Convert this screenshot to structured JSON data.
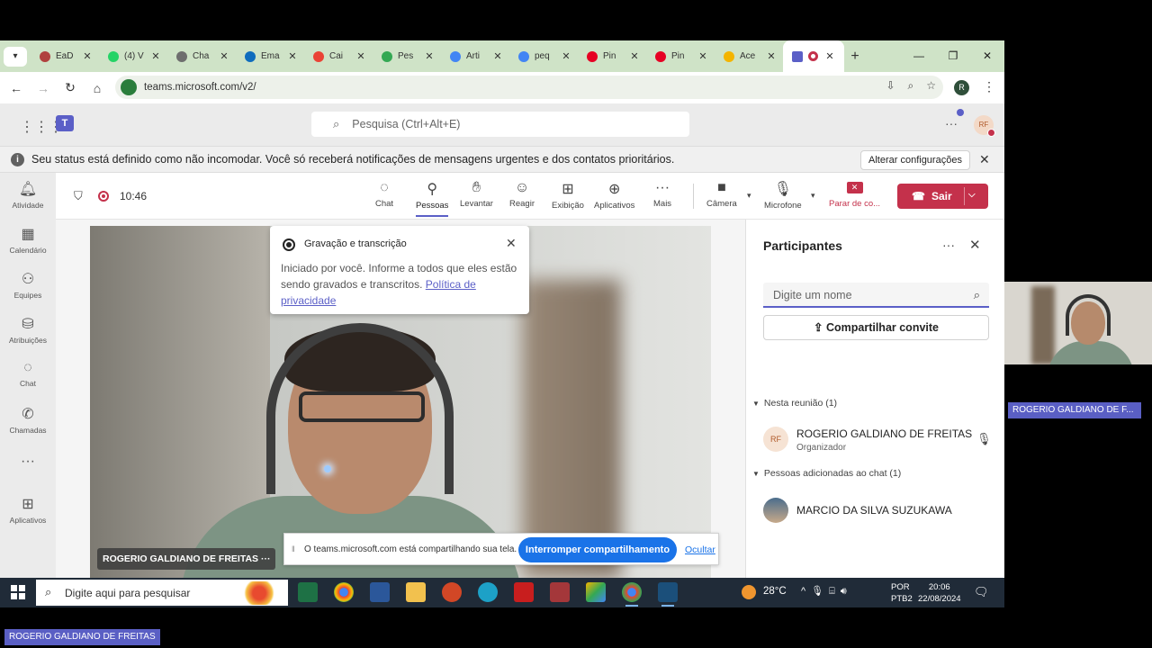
{
  "browser": {
    "tabs": [
      {
        "label": "EaD",
        "color": "#b0413e"
      },
      {
        "label": "(4) V",
        "color": "#25d366"
      },
      {
        "label": "Cha",
        "color": "#6e6e6e"
      },
      {
        "label": "Ema",
        "color": "#0f6cbd"
      },
      {
        "label": "Cai",
        "color": "#ea4335"
      },
      {
        "label": "Pes",
        "color": "#34a853"
      },
      {
        "label": "Arti",
        "color": "#4285f4"
      },
      {
        "label": "peq",
        "color": "#4285f4"
      },
      {
        "label": "Pin",
        "color": "#e60023"
      },
      {
        "label": "Pin",
        "color": "#e60023"
      },
      {
        "label": "Ace",
        "color": "#f4b400"
      }
    ],
    "url": "teams.microsoft.com/v2/",
    "profile_initial": "R"
  },
  "teams": {
    "search_placeholder": "Pesquisa (Ctrl+Alt+E)",
    "avatar_initials": "RF",
    "banner_text": "Seu status está definido como não incomodar. Você só receberá notificações de mensagens urgentes e dos contatos prioritários.",
    "banner_button": "Alterar configurações",
    "rail": [
      {
        "label": "Atividade",
        "icon": "bell-icon"
      },
      {
        "label": "Calendário",
        "icon": "calendar-icon"
      },
      {
        "label": "Equipes",
        "icon": "teams-icon"
      },
      {
        "label": "Atribuições",
        "icon": "assignments-icon"
      },
      {
        "label": "Chat",
        "icon": "chat-icon"
      },
      {
        "label": "Chamadas",
        "icon": "phone-icon"
      },
      {
        "label": "",
        "icon": "more-icon"
      },
      {
        "label": "Aplicativos",
        "icon": "apps-icon"
      }
    ]
  },
  "meeting": {
    "timer": "10:46",
    "toolbar": {
      "chat": "Chat",
      "people": "Pessoas",
      "raise": "Levantar",
      "react": "Reagir",
      "view": "Exibição",
      "apps": "Aplicativos",
      "more": "Mais",
      "camera": "Câmera",
      "mic": "Microfone",
      "stop_share": "Parar de co...",
      "leave": "Sair"
    },
    "video_name": "ROGERIO GALDIANO DE FREITAS",
    "popup": {
      "title": "Gravação e transcrição",
      "body": "Iniciado por você. Informe a todos que eles estão sendo gravados e transcritos.",
      "link": "Política de privacidade"
    },
    "share_bar": {
      "text": "O teams.microsoft.com está compartilhando sua tela.",
      "stop": "Interromper compartilhamento",
      "hide": "Ocultar"
    }
  },
  "participants": {
    "title": "Participantes",
    "search_placeholder": "Digite um nome",
    "share_invite": "Compartilhar convite",
    "section_meeting": "Nesta reunião (1)",
    "section_chat": "Pessoas adicionadas ao chat (1)",
    "people": [
      {
        "initials": "RF",
        "name": "ROGERIO GALDIANO DE FREITAS",
        "role": "Organizador"
      },
      {
        "name": "MARCIO DA SILVA SUZUKAWA"
      }
    ]
  },
  "taskbar": {
    "search_placeholder": "Digite aqui para pesquisar",
    "temp": "28°C",
    "lang1": "POR",
    "lang2": "PTB2",
    "time": "20:06",
    "date": "22/08/2024"
  },
  "overlay": {
    "thumb_name": "ROGERIO GALDIANO DE F...",
    "bottom_name": "ROGERIO GALDIANO DE FREITAS"
  }
}
